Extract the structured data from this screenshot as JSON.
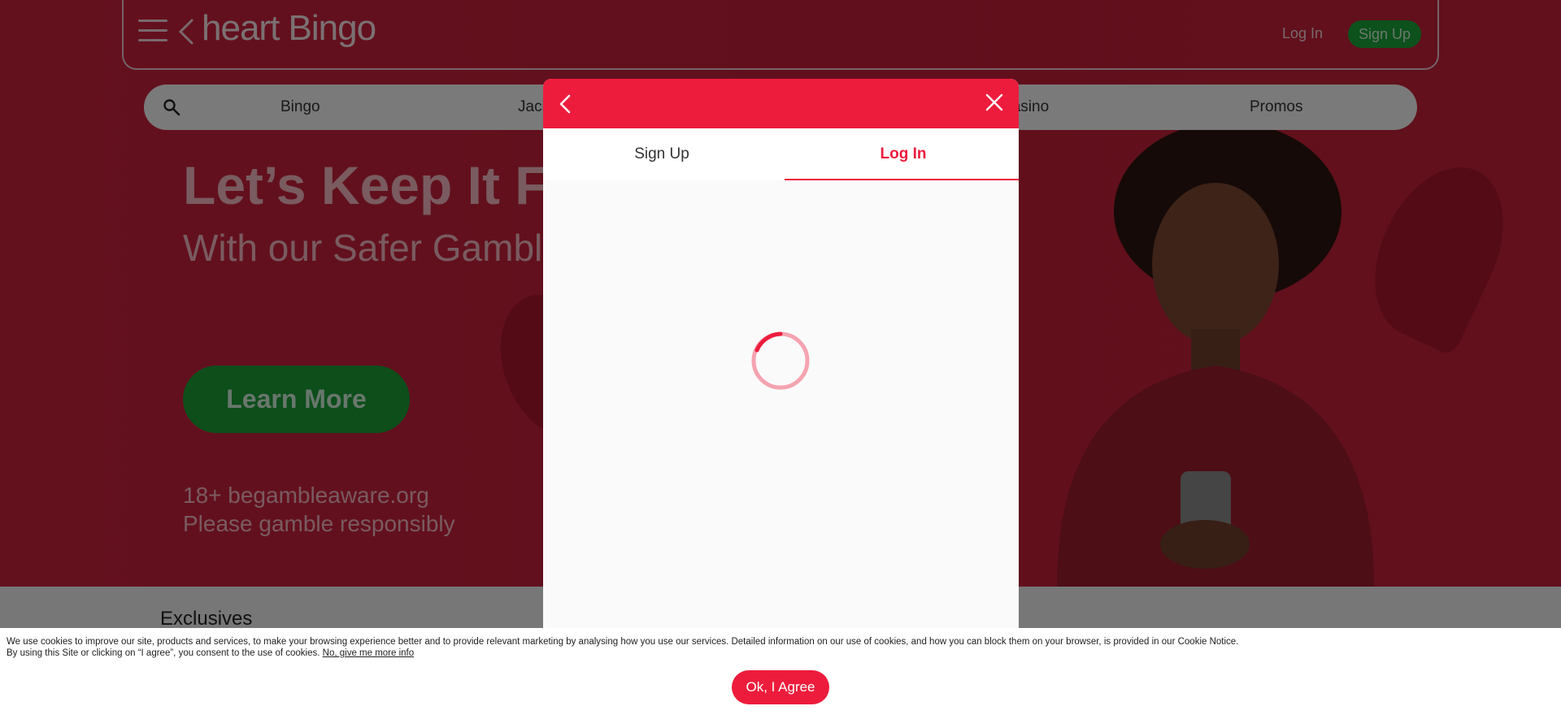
{
  "header": {
    "logo_text": "heart Bingo",
    "login_label": "Log In",
    "signup_label": "Sign Up"
  },
  "nav": {
    "items": [
      "Bingo",
      "Jackpots",
      "Casino",
      "Promos"
    ]
  },
  "hero": {
    "headline": "Let’s Keep It Fun",
    "subheadline": "With our Safer Gambling tools",
    "cta_label": "Learn More",
    "footer_line1": "18+ begambleaware.org",
    "footer_line2": "Please gamble responsibly"
  },
  "section": {
    "exclusives_title": "Exclusives"
  },
  "modal": {
    "tabs": [
      {
        "label": "Sign Up",
        "active": false
      },
      {
        "label": "Log In",
        "active": true
      }
    ],
    "accent_color": "#ed1c3c",
    "state": "loading"
  },
  "cookie_banner": {
    "line1": "We use cookies to improve our site, products and services, to make your browsing experience better and to provide relevant marketing by analysing how you use our services. Detailed information on our use of cookies, and how you can block them on your browser, is provided in our Cookie Notice.",
    "line2": "By using this Site or clicking on “I agree”, you consent to the use of cookies.",
    "more_info_link": "No, give me more info",
    "agree_label": "Ok, I Agree"
  },
  "colors": {
    "brand_red": "#ed1c3c",
    "green": "#1a9c36"
  }
}
